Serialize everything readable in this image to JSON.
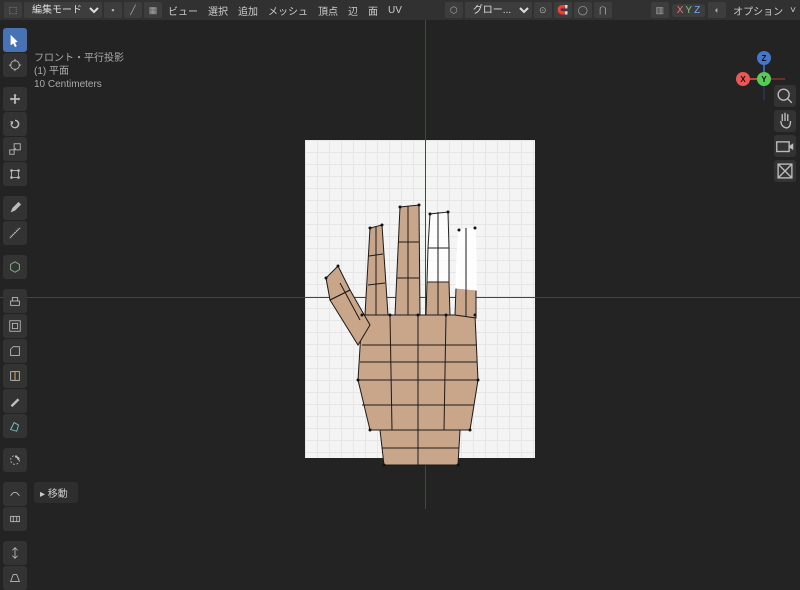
{
  "header": {
    "mode": "編集モード",
    "view_menu": "ビュー",
    "select_menu": "選択",
    "add_menu": "追加",
    "mesh_menu": "メッシュ",
    "vertex_menu": "頂点",
    "edge_menu": "辺",
    "face_menu": "面",
    "uv_menu": "UV",
    "orientation": "グロー...",
    "options": "オプション"
  },
  "viewport_info": {
    "view_name": "フロント・平行投影",
    "object_name": "(1) 平面",
    "scale": "10 Centimeters"
  },
  "gizmo": {
    "x": "X",
    "y": "Y",
    "z": "Z"
  },
  "bottom": {
    "panel": "▸ 移動"
  }
}
